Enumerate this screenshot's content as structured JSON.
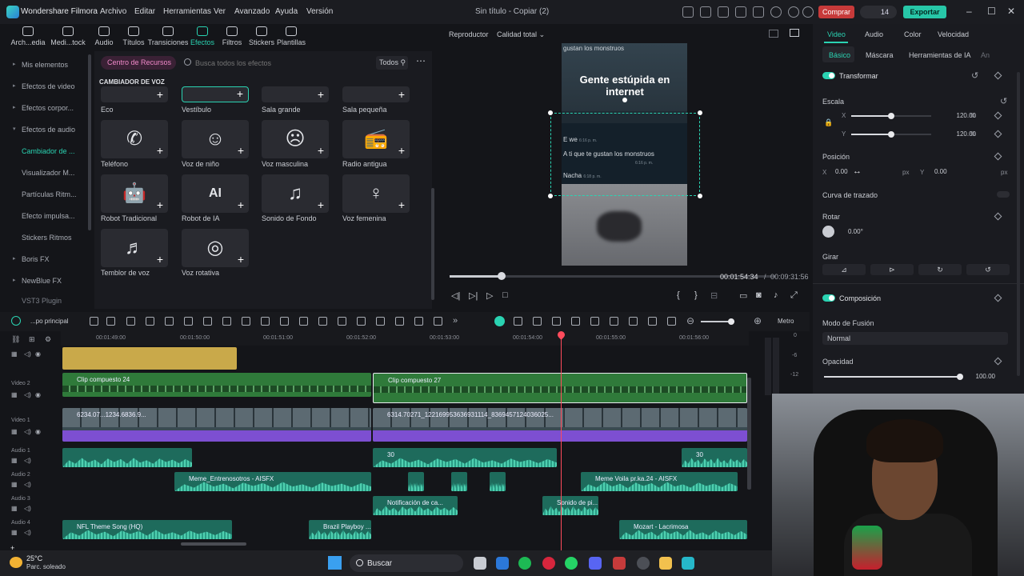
{
  "titlebar": {
    "app_name": "Wondershare Filmora",
    "menu": [
      "Archivo",
      "Editar",
      "Herramientas",
      "Ver",
      "Avanzado",
      "Ayuda",
      "Versión"
    ],
    "document_title": "Sin título - Copiar (2)",
    "buy_label": "Comprar",
    "credits": "14",
    "export_label": "Exportar"
  },
  "media_toolbar": [
    {
      "label": "Arch...edia",
      "icon": "import-icon"
    },
    {
      "label": "Medi...tock",
      "icon": "stock-media-icon"
    },
    {
      "label": "Audio",
      "icon": "music-note-icon"
    },
    {
      "label": "Títulos",
      "icon": "title-icon"
    },
    {
      "label": "Transiciones",
      "icon": "transition-icon"
    },
    {
      "label": "Efectos",
      "icon": "effects-icon",
      "active": true
    },
    {
      "label": "Filtros",
      "icon": "filter-icon"
    },
    {
      "label": "Stickers",
      "icon": "sticker-icon"
    },
    {
      "label": "Plantillas",
      "icon": "template-icon"
    }
  ],
  "sidebar": {
    "items": [
      {
        "label": "Mis elementos",
        "arrow": "▸"
      },
      {
        "label": "Efectos de video",
        "arrow": "▸"
      },
      {
        "label": "Efectos corpor...",
        "arrow": "▸"
      },
      {
        "label": "Efectos de audio",
        "arrow": "▾"
      },
      {
        "label": "Cambiador de ...",
        "arrow": "",
        "active": true
      },
      {
        "label": "Visualizador M...",
        "arrow": ""
      },
      {
        "label": "Partículas Ritm...",
        "arrow": ""
      },
      {
        "label": "Efecto impulsa...",
        "arrow": ""
      },
      {
        "label": "Stickers Ritmos",
        "arrow": ""
      },
      {
        "label": "Boris FX",
        "arrow": "▸"
      },
      {
        "label": "NewBlue FX",
        "arrow": "▸"
      },
      {
        "label": "VST3 Plugin",
        "arrow": ""
      }
    ]
  },
  "effects_panel": {
    "resource_center": "Centro de Recursos",
    "search_placeholder": "Busca todos los efectos",
    "filter_label": "Todos",
    "category_title": "CAMBIADOR DE VOZ",
    "cards": [
      {
        "label": "Eco",
        "glyph": "((·))"
      },
      {
        "label": "Vestíbulo",
        "glyph": "▭",
        "selected": true
      },
      {
        "label": "Sala grande",
        "glyph": "▭"
      },
      {
        "label": "Sala pequeña",
        "glyph": "▭"
      },
      {
        "label": "Teléfono",
        "glyph": "✆"
      },
      {
        "label": "Voz de niño",
        "glyph": "☺"
      },
      {
        "label": "Voz masculina",
        "glyph": "☹"
      },
      {
        "label": "Radio antigua",
        "glyph": "📻"
      },
      {
        "label": "Robot Tradicional",
        "glyph": "🤖"
      },
      {
        "label": "Robot de IA",
        "glyph": "AI"
      },
      {
        "label": "Sonido de Fondo",
        "glyph": "♫"
      },
      {
        "label": "Voz femenina",
        "glyph": "♀"
      },
      {
        "label": "Temblor de voz",
        "glyph": "♬"
      },
      {
        "label": "Voz rotativa",
        "glyph": "◎"
      }
    ]
  },
  "preview": {
    "player_label": "Reproductor",
    "quality": "Calidad total",
    "caption": "Gente estúpida en internet",
    "top_text": "gustan los monstruos",
    "chat": [
      {
        "text": "E we",
        "time": "6:16 p. m."
      },
      {
        "text": "A ti que te gustan los monstruos",
        "time": "6:16 p. m."
      },
      {
        "text": "Nacha",
        "time": "6:18 p. m."
      }
    ],
    "progress": 0.16,
    "current_time": "00:01:54:34",
    "separator": "/",
    "total_time": "00:09:31:56"
  },
  "props": {
    "tabs": [
      "Video",
      "Audio",
      "Color",
      "Velocidad"
    ],
    "subtabs": [
      "Básico",
      "Máscara",
      "Herramientas de IA",
      "An"
    ],
    "transform_label": "Transformar",
    "scale_label": "Escala",
    "scale_x_label": "X",
    "scale_x": "120.00",
    "scale_y_label": "Y",
    "scale_y": "120.00",
    "scale_unit": "%",
    "scale_level": 0.5,
    "position_label": "Posición",
    "pos_x_label": "X",
    "pos_x": "0.00",
    "pos_y_label": "Y",
    "pos_y": "0.00",
    "pos_unit": "px",
    "path_curve_label": "Curva de trazado",
    "rotate_label": "Rotar",
    "rotate_value": "0.00°",
    "flip_label": "Girar",
    "composition_label": "Composición",
    "blend_label": "Modo de Fusión",
    "blend_value": "Normal",
    "opacity_label": "Opacidad",
    "opacity_value": "100.00",
    "opacity_level": 1.0
  },
  "timeline": {
    "scene_label": "...po principal",
    "zoom_label": "Metro",
    "ruler": [
      "00:01:49:00",
      "00:01:50:00",
      "00:01:51:00",
      "00:01:52:00",
      "00:01:53:00",
      "00:01:54:00",
      "00:01:55:00",
      "00:01:56:00"
    ],
    "tracks": [
      {
        "name": ""
      },
      {
        "name": "Video 2"
      },
      {
        "name": "Video 1"
      },
      {
        "name": "Audio 1"
      },
      {
        "name": "Audio 2"
      },
      {
        "name": "Audio 3"
      },
      {
        "name": "Audio 4"
      }
    ],
    "clips": {
      "video2_a": "Clip compuesto 24",
      "video2_b": "Clip compuesto 27",
      "video1_a": "6234.07...1234.6836.9...",
      "video1_b": "6314.70271_122169953636931114_8369457124036025...",
      "audio1_b": "30",
      "audio1_c": "30",
      "audio2_a": "Meme_Entrenosotros - AISFX",
      "audio2_b": "Meme Voila pr.ka.24 - AISFX",
      "audio3_a": "Notificación de ca...",
      "audio3_b": "Sonido de pi...",
      "audio4_a": "NFL Theme Song (HQ)",
      "audio4_b": "Brazil Playboy ...",
      "audio4_c": "Mozart - Lacrimosa"
    },
    "meter": [
      "0",
      "-6",
      "-12"
    ]
  },
  "taskbar": {
    "temperature": "25°C",
    "condition": "Parc. soleado",
    "search_label": "Buscar"
  }
}
